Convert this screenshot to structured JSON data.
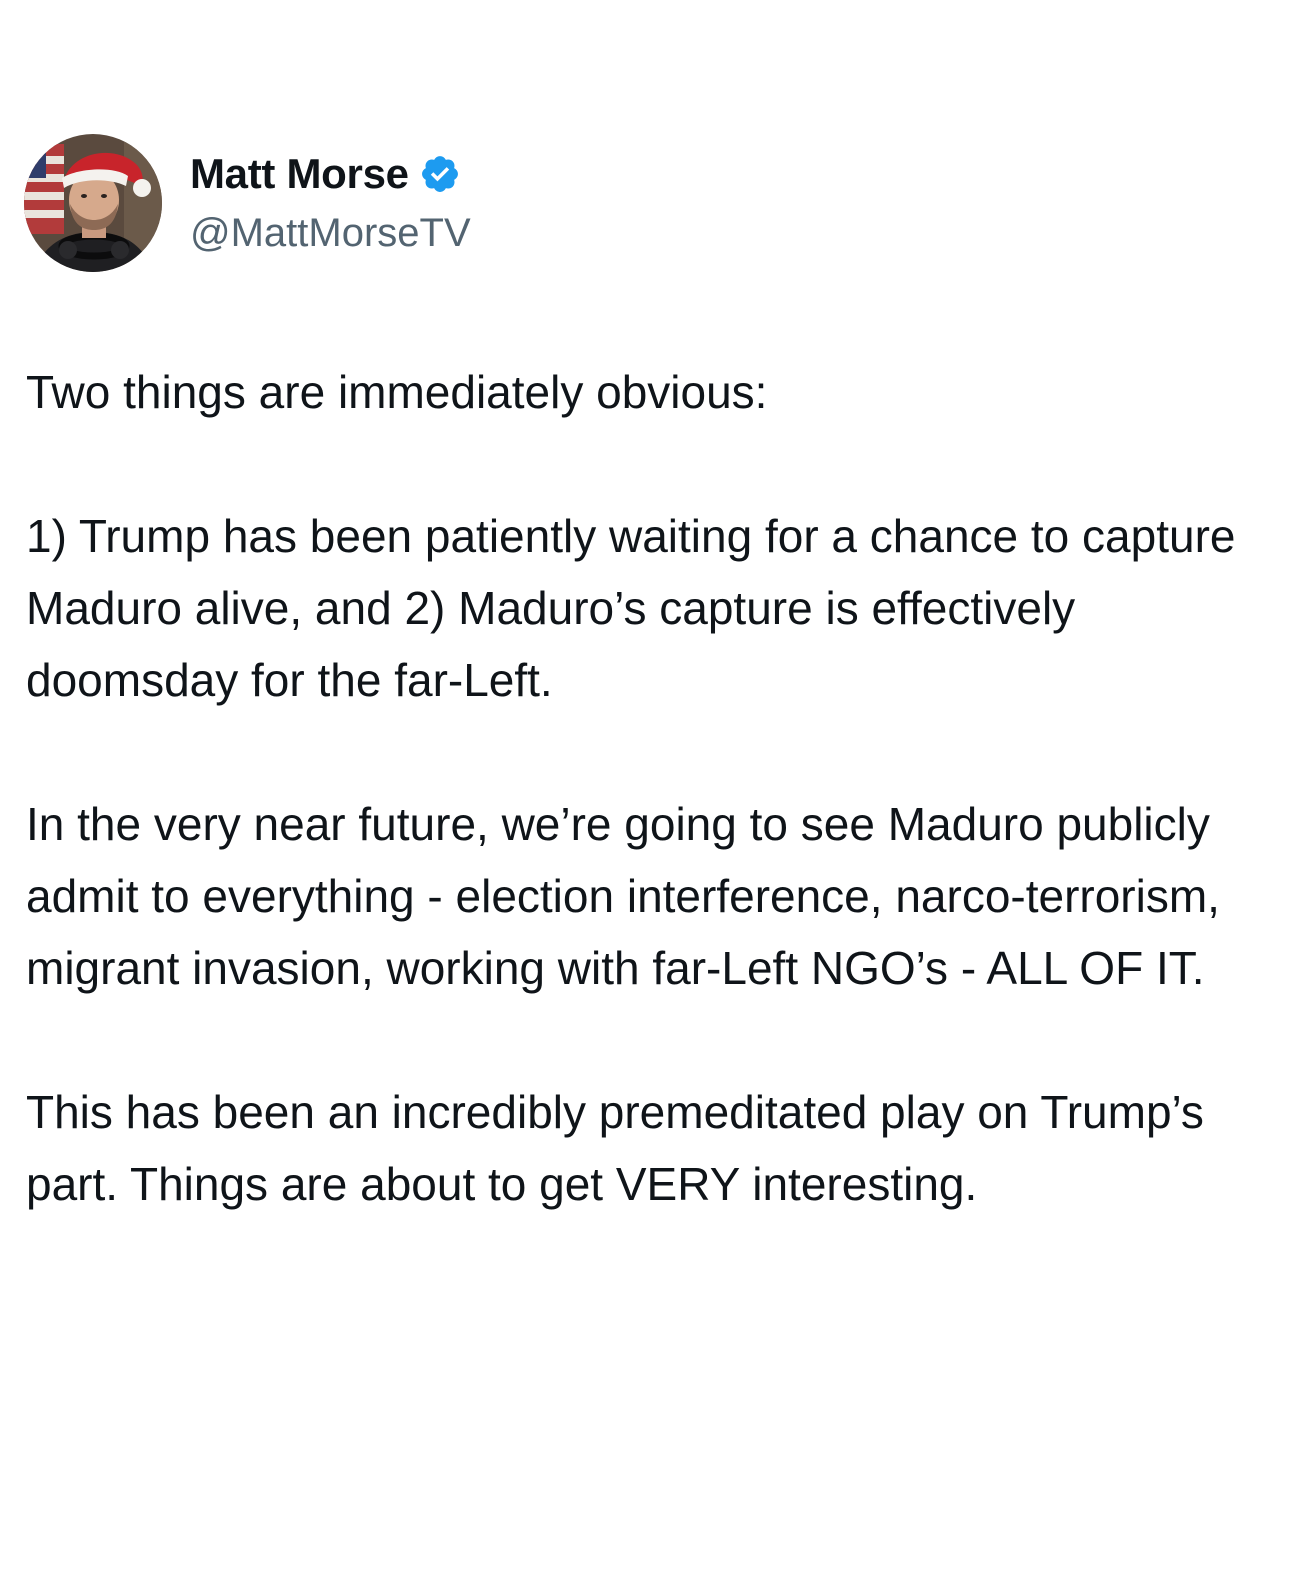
{
  "tweet": {
    "author": {
      "display_name": "Matt Morse",
      "handle": "@MattMorseTV",
      "verified": true,
      "avatar_icon": "user-avatar-santa-hat"
    },
    "paragraphs": [
      "Two things are immediately obvious:",
      "1) Trump has been patiently waiting for a chance to capture Maduro alive, and 2) Maduro’s capture is effectively doomsday for the far-Left.",
      "In the very near future, we’re going to see Maduro publicly admit to everything - election interference, narco-terrorism, migrant invasion, working with far-Left NGO’s - ALL OF IT.",
      "This has been an incredibly premeditated play on Trump’s part. Things are about to get VERY interesting."
    ]
  },
  "colors": {
    "text": "#0f1419",
    "secondary_text": "#536471",
    "verified_badge": "#1d9bf0",
    "background": "#ffffff"
  }
}
